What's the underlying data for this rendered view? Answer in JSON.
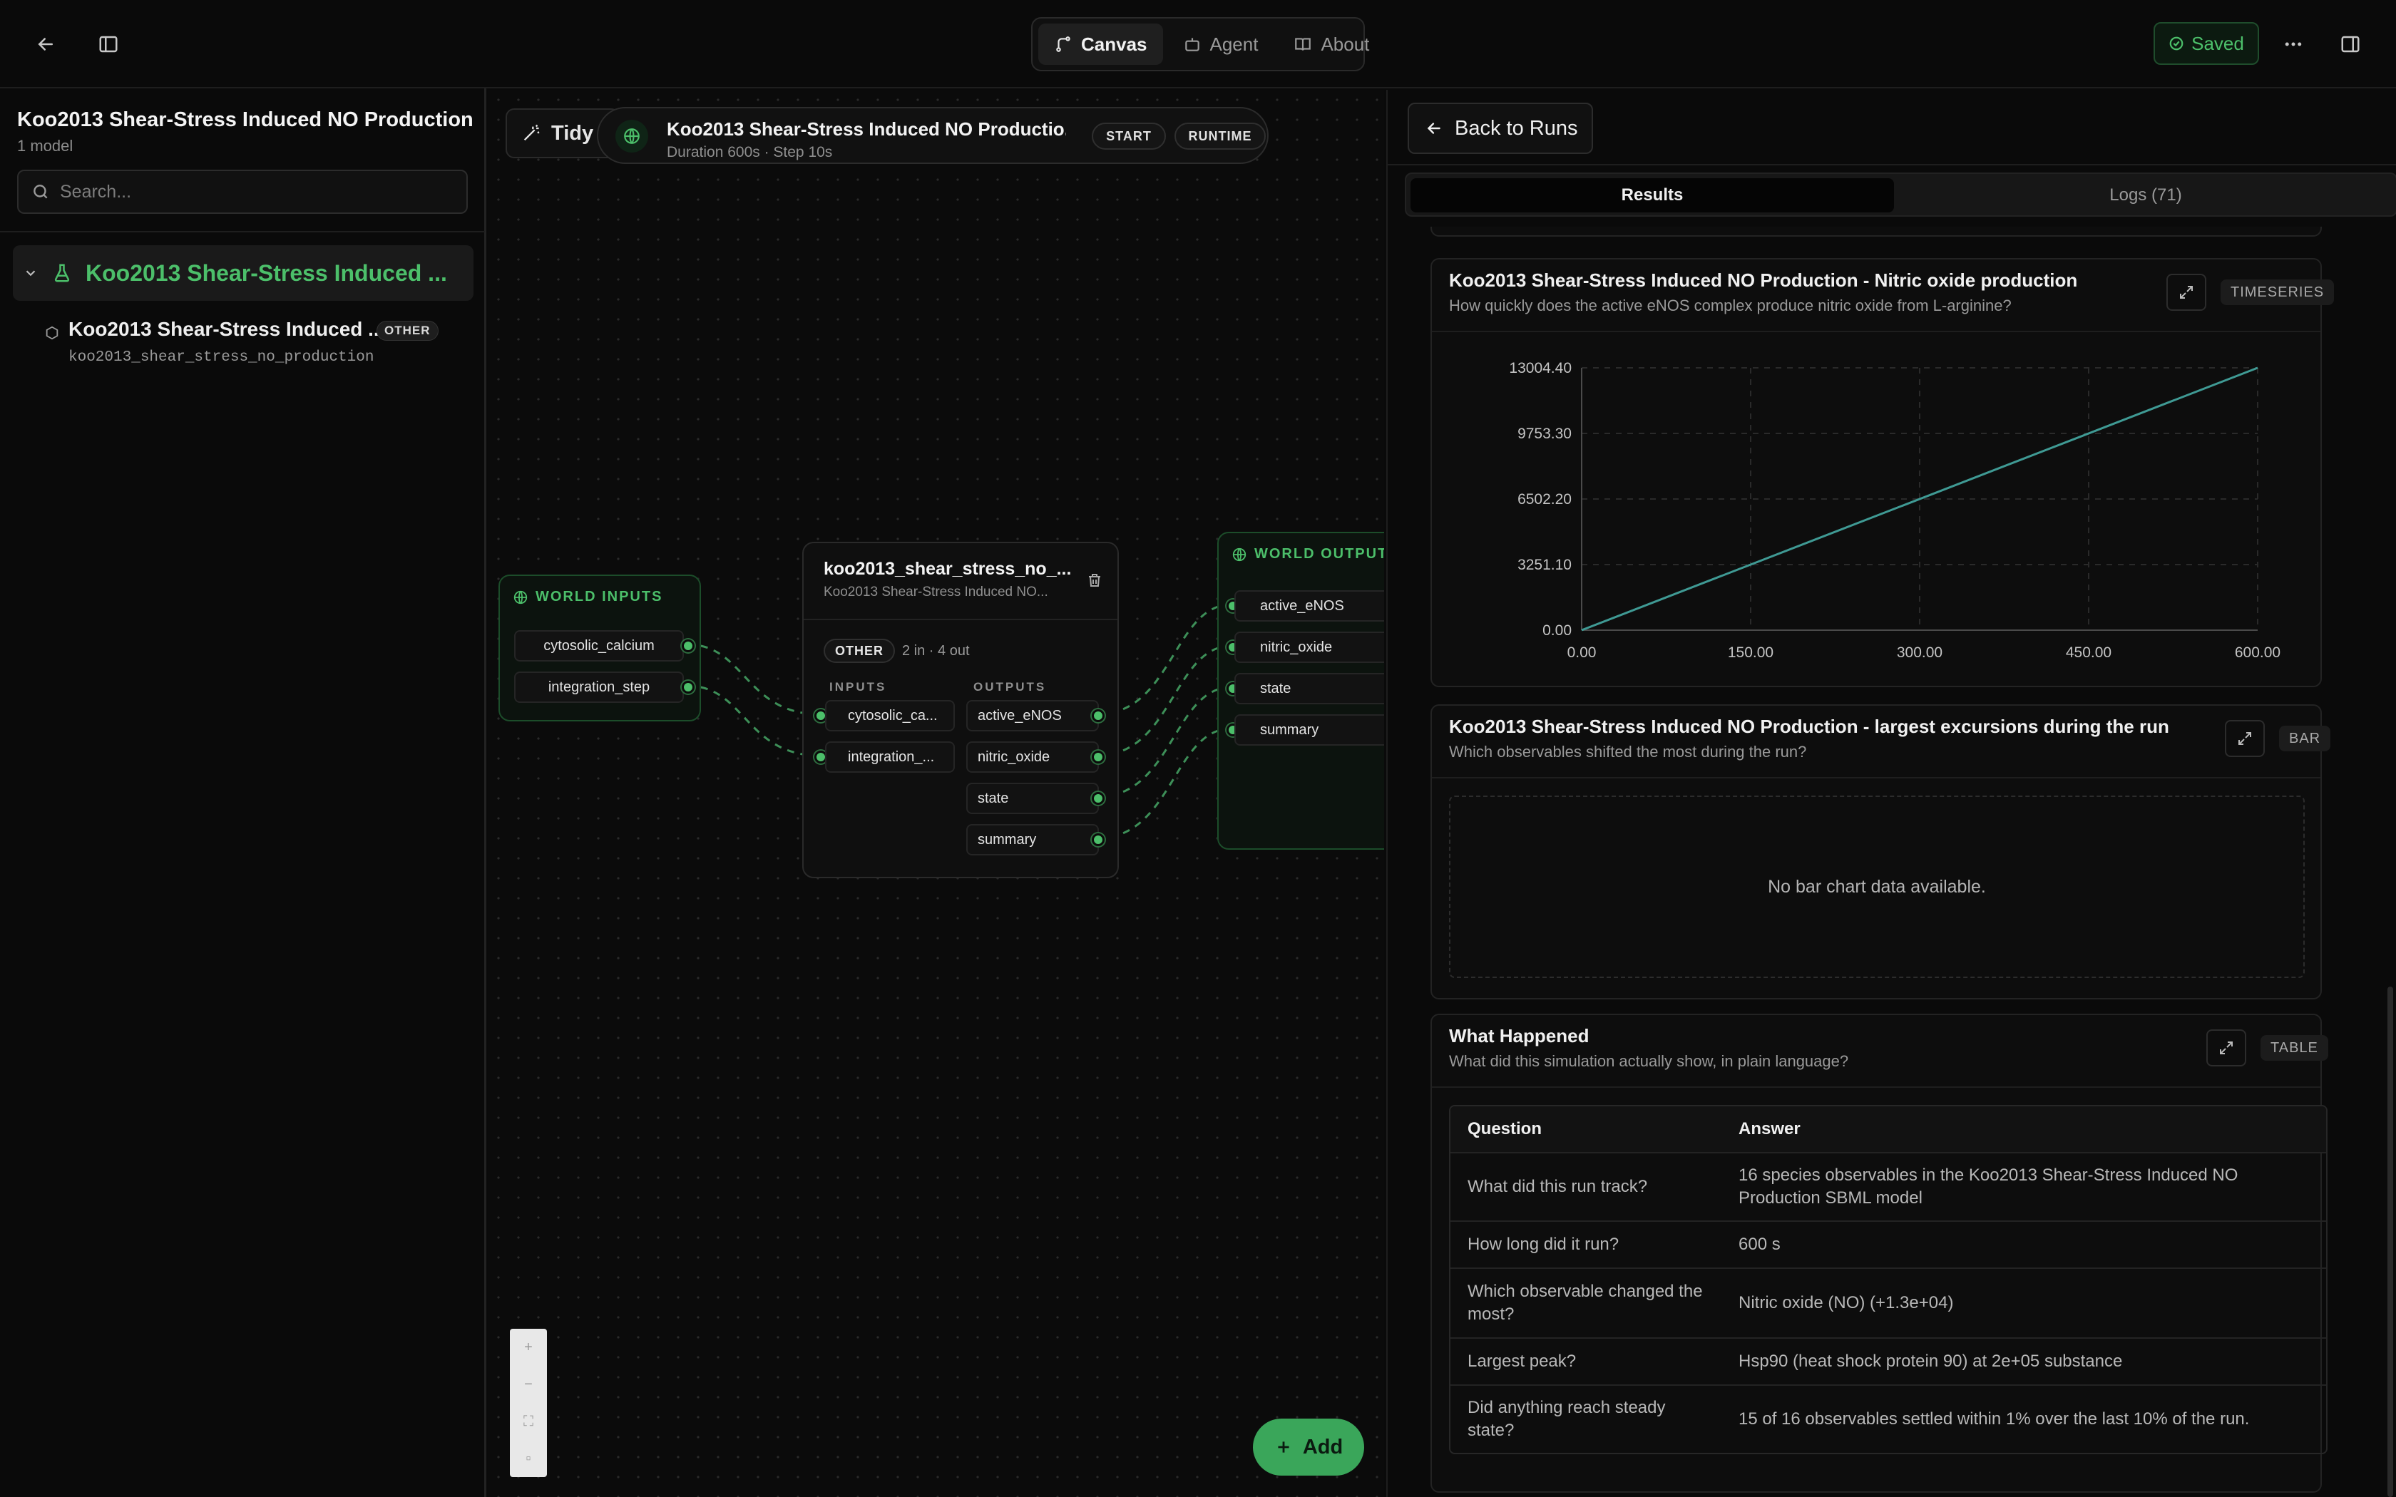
{
  "topbar": {
    "tabs": [
      {
        "label": "Canvas"
      },
      {
        "label": "Agent"
      },
      {
        "label": "About"
      }
    ],
    "saved_label": "Saved"
  },
  "sidebar": {
    "title": "Koo2013 Shear-Stress Induced NO Production...",
    "subtitle": "1 model",
    "search_placeholder": "Search...",
    "group_label": "Koo2013 Shear-Stress Induced ...",
    "model": {
      "name": "Koo2013 Shear-Stress Induced ...",
      "badge": "OTHER",
      "id": "koo2013_shear_stress_no_production"
    }
  },
  "canvas": {
    "tidy_label": "Tidy",
    "run": {
      "title": "Koo2013 Shear-Stress Induced NO Productio...",
      "meta": "Duration 600s · Step 10s",
      "chips": [
        "START",
        "RUNTIME"
      ]
    },
    "world_inputs": {
      "label": "WORLD INPUTS",
      "ports": [
        "cytosolic_calcium",
        "integration_step"
      ]
    },
    "model_node": {
      "title": "koo2013_shear_stress_no_...",
      "subtitle": "Koo2013 Shear-Stress Induced NO...",
      "badge": "OTHER",
      "io": "2 in · 4 out",
      "inputs_label": "INPUTS",
      "outputs_label": "OUTPUTS",
      "inputs": [
        "cytosolic_ca...",
        "integration_..."
      ],
      "outputs": [
        "active_eNOS",
        "nitric_oxide",
        "state",
        "summary"
      ]
    },
    "world_outputs": {
      "label": "WORLD OUTPUTS",
      "ports": [
        "active_eNOS",
        "nitric_oxide",
        "state",
        "summary"
      ]
    },
    "add_label": "Add"
  },
  "panel": {
    "back_label": "Back to Runs",
    "tabs": [
      {
        "label": "Results"
      },
      {
        "label": "Logs (71)"
      }
    ],
    "cards": {
      "timeseries": {
        "title": "Koo2013 Shear-Stress Induced NO Production - Nitric oxide production",
        "subtitle": "How quickly does the active eNOS complex produce nitric oxide from L-arginine?",
        "badge": "TIMESERIES"
      },
      "bar": {
        "title": "Koo2013 Shear-Stress Induced NO Production - largest excursions during the run",
        "subtitle": "Which observables shifted the most during the run?",
        "badge": "BAR",
        "empty_text": "No bar chart data available."
      },
      "table": {
        "title": "What Happened",
        "subtitle": "What did this simulation actually show, in plain language?",
        "badge": "TABLE",
        "headers": [
          "Question",
          "Answer"
        ],
        "rows": [
          {
            "q": "What did this run track?",
            "a": "16 species observables in the Koo2013 Shear-Stress Induced NO Production SBML model"
          },
          {
            "q": "How long did it run?",
            "a": "600 s"
          },
          {
            "q": "Which observable changed the most?",
            "a": "Nitric oxide (NO) (+1.3e+04)"
          },
          {
            "q": "Largest peak?",
            "a": "Hsp90 (heat shock protein 90) at 2e+05 substance"
          },
          {
            "q": "Did anything reach steady state?",
            "a": "15 of 16 observables settled within 1% over the last 10% of the run."
          }
        ]
      }
    }
  },
  "chart_data": {
    "type": "line",
    "x": [
      0,
      600
    ],
    "series": [
      {
        "values": [
          0,
          13004.4
        ]
      }
    ],
    "xticks": [
      "0.00",
      "150.00",
      "300.00",
      "450.00",
      "600.00"
    ],
    "yticks": [
      "0.00",
      "3251.10",
      "6502.20",
      "9753.30",
      "13004.40"
    ],
    "xlim": [
      0,
      600
    ],
    "ylim": [
      0,
      13004.4
    ],
    "grid": true,
    "line_color": "#3f9a94"
  }
}
